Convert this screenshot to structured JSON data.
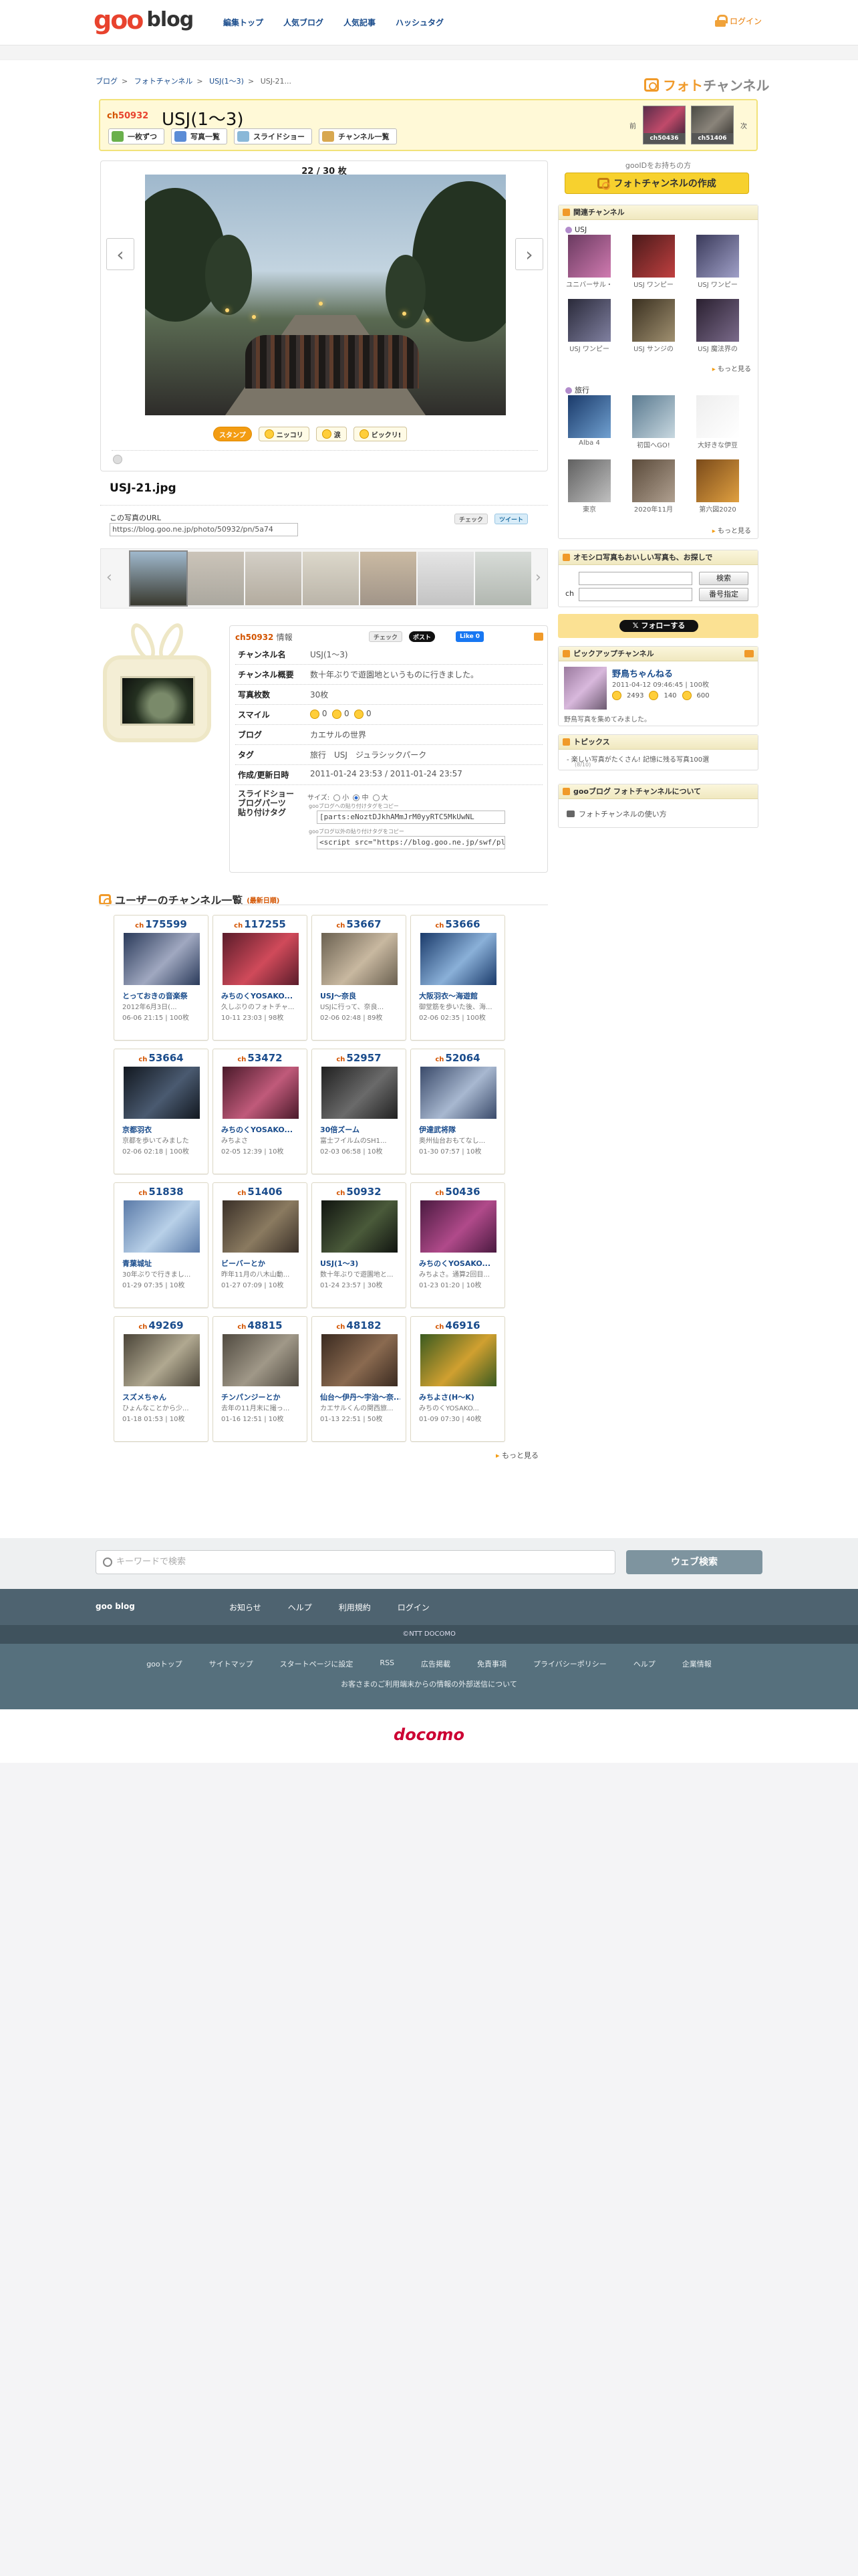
{
  "header": {
    "logo_goo": "goo",
    "logo_blog": "blog",
    "nav": [
      "編集トップ",
      "人気ブログ",
      "人気記事",
      "ハッシュタグ"
    ],
    "login": "ログイン"
  },
  "breadcrumb": [
    "ブログ",
    "フォトチャンネル",
    "USJ(1〜3)",
    "USJ-21..."
  ],
  "photochannel_logo": {
    "a": "フォト",
    "b": "チャンネル"
  },
  "channel": {
    "ch_prefix": "ch",
    "number": "50932",
    "title": "USJ(1〜3)",
    "buttons": [
      "一枚ずつ",
      "写真一覧",
      "スライドショー",
      "チャンネル一覧"
    ],
    "prev_label": "前",
    "next_label": "次",
    "prev_ch": "ch50436",
    "next_ch": "ch51406"
  },
  "viewer": {
    "counter": "22 / 30 枚",
    "reactions": [
      "スタンプ",
      "ニッコリ",
      "涙",
      "ビックリ!"
    ],
    "filename": "USJ-21.jpg",
    "url_label": "この写真のURL",
    "url_value": "https://blog.goo.ne.jp/photo/50932/pn/5a74",
    "check_label": "チェック",
    "tweet_label": "ツイート"
  },
  "info": {
    "header_no": "ch50932",
    "header_suffix": "情報",
    "share": {
      "check": "チェック",
      "post": "ポスト",
      "like": "Like 0"
    },
    "rows": {
      "channel_name_k": "チャンネル名",
      "channel_name_v": "USJ(1〜3)",
      "overview_k": "チャンネル概要",
      "overview_v": "数十年ぶりで遊園地というものに行きました。",
      "count_k": "写真枚数",
      "count_v": "30枚",
      "smile_k": "スマイル",
      "smile_a": "0",
      "smile_b": "0",
      "smile_c": "0",
      "blog_k": "ブログ",
      "blog_v": "カエサルの世界",
      "tag_k": "タグ",
      "tag_v": "旅行　USJ　ジュラシックパーク",
      "date_k": "作成/更新日時",
      "date_v": "2011-01-24 23:53 / 2011-01-24 23:57",
      "parts_k1": "スライドショー",
      "parts_k2": "ブログパーツ",
      "parts_k3": "貼り付けタグ",
      "size_label": "サイズ:",
      "size_s": "小",
      "size_m": "中",
      "size_l": "大",
      "note1": "gooブログへの貼り付けタグをコピー",
      "code1": "[parts:eNoztDJkhAMmJrM0yyRTC5MkUwNL",
      "note2": "gooブログ以外の貼り付けタグをコピー",
      "code2": "<script src=\"https://blog.goo.ne.jp/swf/pl"
    }
  },
  "user_channels": {
    "title": "ユーザーのチャンネル一覧",
    "subtitle": "(最新日順)",
    "ch_prefix": "ch",
    "more": "もっと見る",
    "items": [
      {
        "no": "175599",
        "title": "とっておきの音楽祭",
        "desc": "2012年6月3日(...",
        "date": "06-06 21:15 | 100枚"
      },
      {
        "no": "117255",
        "title": "みちのくYOSAKO...",
        "desc": "久しぶりのフォトチャ...",
        "date": "10-11 23:03 | 98枚"
      },
      {
        "no": "53667",
        "title": "USJ〜奈良",
        "desc": "USJに行って、奈良...",
        "date": "02-06 02:48 | 89枚"
      },
      {
        "no": "53666",
        "title": "大阪羽衣〜海遊館",
        "desc": "御堂筋を歩いた後、海...",
        "date": "02-06 02:35 | 100枚"
      },
      {
        "no": "53664",
        "title": "京都羽衣",
        "desc": "京都を歩いてみました",
        "date": "02-06 02:18 | 100枚"
      },
      {
        "no": "53472",
        "title": "みちのくYOSAKO...",
        "desc": "みちよさ",
        "date": "02-05 12:39 | 10枚"
      },
      {
        "no": "52957",
        "title": "30倍ズーム",
        "desc": "富士フイルムのSH1...",
        "date": "02-03 06:58 | 10枚"
      },
      {
        "no": "52064",
        "title": "伊達武将隊",
        "desc": "奥州仙台おもてなし...",
        "date": "01-30 07:57 | 10枚"
      },
      {
        "no": "51838",
        "title": "青葉城址",
        "desc": "30年ぶりで行きまし...",
        "date": "01-29 07:35 | 10枚"
      },
      {
        "no": "51406",
        "title": "ビーバーとか",
        "desc": "昨年11月の八木山動...",
        "date": "01-27 07:09 | 10枚"
      },
      {
        "no": "50932",
        "title": "USJ(1〜3)",
        "desc": "数十年ぶりで遊園地と...",
        "date": "01-24 23:57 | 30枚"
      },
      {
        "no": "50436",
        "title": "みちのくYOSAKO...",
        "desc": "みちよさ。通算2回目...",
        "date": "01-23 01:20 | 10枚"
      },
      {
        "no": "49269",
        "title": "スズメちゃん",
        "desc": "ひょんなことから少...",
        "date": "01-18 01:53 | 10枚"
      },
      {
        "no": "48815",
        "title": "チンパンジーとか",
        "desc": "去年の11月末に撮っ...",
        "date": "01-16 12:51 | 10枚"
      },
      {
        "no": "48182",
        "title": "仙台〜伊丹〜宇治〜奈...",
        "desc": "カエサルくんの関西旅...",
        "date": "01-13 22:51 | 50枚"
      },
      {
        "no": "46916",
        "title": "みちよさ(H〜K)",
        "desc": "みちのくYOSAKO...",
        "date": "01-09 07:30 | 40枚"
      }
    ]
  },
  "right": {
    "follow_text": "gooIDをお持ちの方",
    "create_btn": "フォトチャンネルの作成",
    "related": {
      "title": "関連チャンネル",
      "sub1": "USJ",
      "usj": [
        "ユニバーサル・",
        "USJ ワンピー",
        "USJ ワンピー",
        "USJ ワンピー",
        "USJ サンジの",
        "USJ 魔法界の"
      ],
      "more": "もっと見る",
      "sub2": "旅行",
      "travel": [
        "Alba 4",
        "初国へGO!",
        "大好きな伊豆",
        "東京",
        "2020年11月",
        "第六図2020"
      ]
    },
    "search": {
      "title": "オモシロ写真もおいしい写真も、お探しで",
      "search_btn": "検索",
      "ch_label": "ch",
      "no_btn": "番号指定"
    },
    "twitter_follow": "フォローする",
    "pickup": {
      "title": "ピックアップチャンネル",
      "name": "野鳥ちゃんねる",
      "date": "2011-04-12 09:46:45 | 100枚",
      "c1": "2493",
      "c2": "140",
      "c3": "600",
      "desc": "野鳥写真を集めてみました。"
    },
    "topics": {
      "title": "トピックス",
      "item": "楽しい写真がたくさん! 記憶に残る写真100選",
      "item_date": "(8/10)"
    },
    "about": {
      "title": "gooブログ フォトチャンネルについて",
      "item": "フォトチャンネルの使い方"
    }
  },
  "search_bar": {
    "placeholder": "キーワードで検索",
    "button": "ウェブ検索"
  },
  "footer": {
    "logo": "goo blog",
    "nav": [
      "お知らせ",
      "ヘルプ",
      "利用規約",
      "ログイン"
    ],
    "copyright": "©NTT DOCOMO",
    "links": [
      "gooトップ",
      "サイトマップ",
      "スタートページに設定",
      "RSS",
      "広告掲載",
      "免責事項",
      "プライバシーポリシー",
      "ヘルプ",
      "企業情報"
    ],
    "note": "お客さまのご利用端末からの情報の外部送信について",
    "docomo": "docomo"
  }
}
